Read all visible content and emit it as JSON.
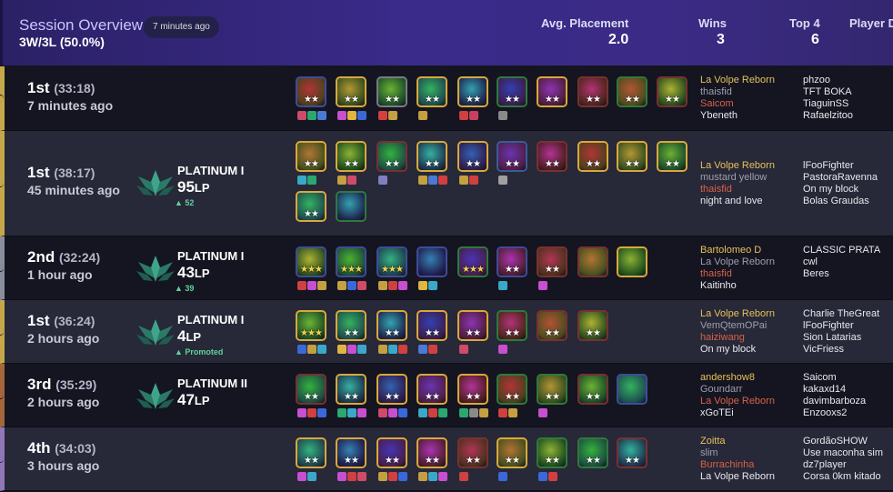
{
  "header": {
    "title": "Session Overview",
    "badge": "7 minutes ago",
    "record": "3W/3L (50.0%)",
    "avg_label": "Avg. Placement",
    "avg_value": "2.0",
    "wins_label": "Wins",
    "wins_value": "3",
    "top4_label": "Top 4",
    "top4_value": "6",
    "player_label": "Player D"
  },
  "colors": {
    "header_gradient_start": "#2b2166",
    "header_gradient_end": "#34276f",
    "row_dark": "#141520",
    "row_light": "#272838",
    "first_place": "#c6a84a",
    "second_place": "#8a8d9c",
    "third_place": "#a6663c",
    "fourth_place": "#8f77b8",
    "lp_gain": "#5ed39a",
    "player_highlight": "#e6c15a",
    "player_red": "#d8614a"
  },
  "matches": [
    {
      "placement": "1st",
      "duration": "(33:18)",
      "ago": "7 minutes ago",
      "rank": null,
      "units": [
        {
          "stars": "★★",
          "frame": "#3f4b9a",
          "gold": false,
          "items": [
            "#d04a6a",
            "#2aa870",
            "#4a7ad6"
          ]
        },
        {
          "stars": "★★",
          "frame": "#d9a83a",
          "gold": false,
          "items": [
            "#c74fd0",
            "#e0b640",
            "#3a68d8"
          ]
        },
        {
          "stars": "★★",
          "frame": "#7a7a86",
          "gold": false,
          "items": [
            "#d44040",
            "#c5a040"
          ]
        },
        {
          "stars": "★★",
          "frame": "#d9a83a",
          "gold": false,
          "items": [
            "#c5a040"
          ]
        },
        {
          "stars": "★★",
          "frame": "#d9a83a",
          "gold": false,
          "items": [
            "#d04040",
            "#c84060"
          ]
        },
        {
          "stars": "★★",
          "frame": "#2e7a3a",
          "gold": false,
          "items": [
            "#8a8a8a"
          ]
        },
        {
          "stars": "★★",
          "frame": "#d9a83a",
          "gold": false,
          "items": []
        },
        {
          "stars": "★★",
          "frame": "#7a3030",
          "gold": false,
          "items": []
        },
        {
          "stars": "★★",
          "frame": "#2e7a3a",
          "gold": false,
          "items": []
        },
        {
          "stars": "★★",
          "frame": "#7a3030",
          "gold": false,
          "items": []
        }
      ],
      "players_left": [
        {
          "name": "La Volpe Reborn",
          "tone": "gold"
        },
        {
          "name": "thaisfid",
          "tone": "gray"
        },
        {
          "name": "Saicom",
          "tone": "red"
        },
        {
          "name": "Ybeneth",
          "tone": "white"
        }
      ],
      "players_right": [
        {
          "name": "phzoo",
          "tone": "white"
        },
        {
          "name": "TFT BOKA",
          "tone": "white"
        },
        {
          "name": "TiaguinSS",
          "tone": "white"
        },
        {
          "name": "Rafaelzitoo",
          "tone": "white"
        }
      ]
    },
    {
      "placement": "1st",
      "duration": "(38:17)",
      "ago": "45 minutes ago",
      "rank": {
        "name": "PLATINUM I",
        "lp": "95",
        "lp_unit": "LP",
        "delta": "▲ 52"
      },
      "units": [
        {
          "stars": "★★",
          "frame": "#d9a83a",
          "gold": false,
          "items": [
            "#3aa8c8",
            "#2aa870"
          ]
        },
        {
          "stars": "★★",
          "frame": "#d9a83a",
          "gold": false,
          "items": [
            "#c5a040",
            "#d04a6a"
          ]
        },
        {
          "stars": "★★",
          "frame": "#7a3030",
          "gold": false,
          "items": [
            "#8080c0"
          ]
        },
        {
          "stars": "★★",
          "frame": "#d9a83a",
          "gold": false,
          "items": [
            "#c5a040",
            "#4a7ad6",
            "#d04040"
          ]
        },
        {
          "stars": "★★",
          "frame": "#d9a83a",
          "gold": false,
          "items": [
            "#c5a040",
            "#d04040"
          ]
        },
        {
          "stars": "★★",
          "frame": "#3a5a9a",
          "gold": false,
          "items": [
            "#a0a0a0"
          ]
        },
        {
          "stars": "★★",
          "frame": "#7a3030",
          "gold": false,
          "items": []
        },
        {
          "stars": "★★",
          "frame": "#d9a83a",
          "gold": false,
          "items": []
        },
        {
          "stars": "★★",
          "frame": "#d9a83a",
          "gold": false,
          "items": []
        },
        {
          "stars": "★★",
          "frame": "#d9a83a",
          "gold": false,
          "items": []
        },
        {
          "stars": "★★",
          "frame": "#d9a83a",
          "gold": false,
          "items": []
        },
        {
          "stars": "",
          "frame": "#2e7a3a",
          "gold": false,
          "items": []
        }
      ],
      "players_left": [
        {
          "name": "La Volpe Reborn",
          "tone": "gold"
        },
        {
          "name": "mustard yellow",
          "tone": "gray"
        },
        {
          "name": "thaisfid",
          "tone": "red"
        },
        {
          "name": "night and love",
          "tone": "white"
        }
      ],
      "players_right": [
        {
          "name": "lFooFighter",
          "tone": "white"
        },
        {
          "name": "PastoraRavenna",
          "tone": "white"
        },
        {
          "name": "On my block",
          "tone": "white"
        },
        {
          "name": "Bolas Graudas",
          "tone": "white"
        }
      ]
    },
    {
      "placement": "2nd",
      "duration": "(32:24)",
      "ago": "1 hour ago",
      "rank": {
        "name": "PLATINUM I",
        "lp": "43",
        "lp_unit": "LP",
        "delta": "▲ 39"
      },
      "units": [
        {
          "stars": "★★★",
          "frame": "#3f4b9a",
          "gold": true,
          "items": [
            "#d04040",
            "#c74fd0",
            "#c5a040"
          ]
        },
        {
          "stars": "★★★",
          "frame": "#3f4b9a",
          "gold": true,
          "items": [
            "#c5a040",
            "#3a68d8",
            "#d04a6a"
          ]
        },
        {
          "stars": "★★★",
          "frame": "#3f4b9a",
          "gold": true,
          "items": [
            "#c5a040",
            "#d04040",
            "#c74fd0"
          ]
        },
        {
          "stars": "",
          "frame": "#3f4b9a",
          "gold": false,
          "items": [
            "#e0b640",
            "#3aa8c8"
          ]
        },
        {
          "stars": "★★★",
          "frame": "#2e7a3a",
          "gold": true,
          "items": []
        },
        {
          "stars": "★★",
          "frame": "#3f4b9a",
          "gold": false,
          "items": [
            "#3aa8c8"
          ]
        },
        {
          "stars": "★★",
          "frame": "#7a3030",
          "gold": false,
          "items": [
            "#c74fd0"
          ]
        },
        {
          "stars": "",
          "frame": "#7a3030",
          "gold": false,
          "items": []
        },
        {
          "stars": "",
          "frame": "#d9a83a",
          "gold": false,
          "items": []
        }
      ],
      "players_left": [
        {
          "name": "Bartolomeo D",
          "tone": "gold"
        },
        {
          "name": "La Volpe Reborn",
          "tone": "gray"
        },
        {
          "name": "thaisfid",
          "tone": "red"
        },
        {
          "name": "Kaitinho",
          "tone": "white"
        }
      ],
      "players_right": [
        {
          "name": "CLASSIC PRATA",
          "tone": "white"
        },
        {
          "name": "cwl",
          "tone": "white"
        },
        {
          "name": "Beres",
          "tone": "white"
        }
      ]
    },
    {
      "placement": "1st",
      "duration": "(36:24)",
      "ago": "2 hours ago",
      "rank": {
        "name": "PLATINUM I",
        "lp": "4",
        "lp_unit": "LP",
        "delta": "▲ Promoted"
      },
      "units": [
        {
          "stars": "★★★",
          "frame": "#d9a83a",
          "gold": true,
          "items": [
            "#3a68d8",
            "#c5a040",
            "#3aa8c8"
          ]
        },
        {
          "stars": "★★",
          "frame": "#d9a83a",
          "gold": false,
          "items": [
            "#e0b640",
            "#c74fd0",
            "#3aa8c8"
          ]
        },
        {
          "stars": "★★",
          "frame": "#d9a83a",
          "gold": false,
          "items": [
            "#c5a040",
            "#3aa8c8",
            "#d04040"
          ]
        },
        {
          "stars": "★★",
          "frame": "#d9a83a",
          "gold": false,
          "items": [
            "#4a7ad6",
            "#d04040"
          ]
        },
        {
          "stars": "★★",
          "frame": "#d9a83a",
          "gold": false,
          "items": [
            "#d04a6a"
          ]
        },
        {
          "stars": "★★",
          "frame": "#2e7a3a",
          "gold": false,
          "items": [
            "#c74fd0"
          ]
        },
        {
          "stars": "★★",
          "frame": "#7a3030",
          "gold": false,
          "items": []
        },
        {
          "stars": "★★",
          "frame": "#7a3030",
          "gold": false,
          "items": []
        }
      ],
      "players_left": [
        {
          "name": "La Volpe Reborn",
          "tone": "gold"
        },
        {
          "name": "VemQtemOPai",
          "tone": "gray"
        },
        {
          "name": "haiziwang",
          "tone": "red"
        },
        {
          "name": "On my block",
          "tone": "white"
        }
      ],
      "players_right": [
        {
          "name": "Charlie TheGreat",
          "tone": "white"
        },
        {
          "name": "lFooFighter",
          "tone": "white"
        },
        {
          "name": "Sion Latarias",
          "tone": "white"
        },
        {
          "name": "VicFriess",
          "tone": "white"
        }
      ]
    },
    {
      "placement": "3rd",
      "duration": "(35:29)",
      "ago": "2 hours ago",
      "rank": {
        "name": "PLATINUM II",
        "lp": "47",
        "lp_unit": "LP",
        "delta": ""
      },
      "units": [
        {
          "stars": "★★",
          "frame": "#7a3030",
          "gold": false,
          "items": [
            "#c74fd0",
            "#d04040",
            "#3a68d8"
          ]
        },
        {
          "stars": "★★",
          "frame": "#d9a83a",
          "gold": false,
          "items": [
            "#2aa870",
            "#3aa8c8",
            "#c74fd0"
          ]
        },
        {
          "stars": "★★",
          "frame": "#d9a83a",
          "gold": false,
          "items": [
            "#d04a6a",
            "#c74fd0",
            "#3a68d8"
          ]
        },
        {
          "stars": "★★",
          "frame": "#d9a83a",
          "gold": false,
          "items": [
            "#3aa8c8",
            "#d04040",
            "#2aa870"
          ]
        },
        {
          "stars": "★★",
          "frame": "#d9a83a",
          "gold": false,
          "items": [
            "#2aa870",
            "#8a8a8a",
            "#c5a040"
          ]
        },
        {
          "stars": "★★",
          "frame": "#2e7a3a",
          "gold": false,
          "items": [
            "#d04040",
            "#c5a040"
          ]
        },
        {
          "stars": "★★",
          "frame": "#2e7a3a",
          "gold": false,
          "items": [
            "#c74fd0"
          ]
        },
        {
          "stars": "★★",
          "frame": "#7a3030",
          "gold": false,
          "items": []
        },
        {
          "stars": "",
          "frame": "#3f4b9a",
          "gold": false,
          "items": []
        }
      ],
      "players_left": [
        {
          "name": "andershow8",
          "tone": "gold"
        },
        {
          "name": "Goundarr",
          "tone": "gray"
        },
        {
          "name": "La Volpe Reborn",
          "tone": "red"
        },
        {
          "name": "xGoTEi",
          "tone": "white"
        }
      ],
      "players_right": [
        {
          "name": "Saicom",
          "tone": "white"
        },
        {
          "name": "kakaxd14",
          "tone": "white"
        },
        {
          "name": "davimbarboza",
          "tone": "white"
        },
        {
          "name": "Enzooxs2",
          "tone": "white"
        }
      ]
    },
    {
      "placement": "4th",
      "duration": "(34:03)",
      "ago": "3 hours ago",
      "rank": null,
      "units": [
        {
          "stars": "★★",
          "frame": "#d9a83a",
          "gold": false,
          "items": [
            "#c74fd0",
            "#3aa8c8"
          ]
        },
        {
          "stars": "★★",
          "frame": "#d9a83a",
          "gold": false,
          "items": [
            "#c74fd0",
            "#d04040",
            "#d04a6a"
          ]
        },
        {
          "stars": "★★",
          "frame": "#d9a83a",
          "gold": false,
          "items": [
            "#c5a040",
            "#d04040",
            "#3a68d8"
          ]
        },
        {
          "stars": "★★",
          "frame": "#d9a83a",
          "gold": false,
          "items": [
            "#c5a040",
            "#3aa8c8",
            "#c74fd0"
          ]
        },
        {
          "stars": "★★",
          "frame": "#7a3030",
          "gold": false,
          "items": [
            "#d04040"
          ]
        },
        {
          "stars": "★★",
          "frame": "#d9a83a",
          "gold": false,
          "items": [
            "#3a68d8"
          ]
        },
        {
          "stars": "★★",
          "frame": "#2e7a3a",
          "gold": false,
          "items": [
            "#3a68d8",
            "#d04040"
          ]
        },
        {
          "stars": "★★",
          "frame": "#2e7a3a",
          "gold": false,
          "items": []
        },
        {
          "stars": "★★",
          "frame": "#7a3030",
          "gold": false,
          "items": []
        }
      ],
      "players_left": [
        {
          "name": "Zoitta",
          "tone": "gold"
        },
        {
          "name": "slim",
          "tone": "gray"
        },
        {
          "name": "Burrachinha",
          "tone": "red"
        },
        {
          "name": "La Volpe Reborn",
          "tone": "white"
        }
      ],
      "players_right": [
        {
          "name": "GordãoSHOW",
          "tone": "white"
        },
        {
          "name": "Use maconha sim",
          "tone": "white"
        },
        {
          "name": "dz7player",
          "tone": "white"
        },
        {
          "name": "Corsa 0km kitado",
          "tone": "white"
        }
      ]
    }
  ]
}
